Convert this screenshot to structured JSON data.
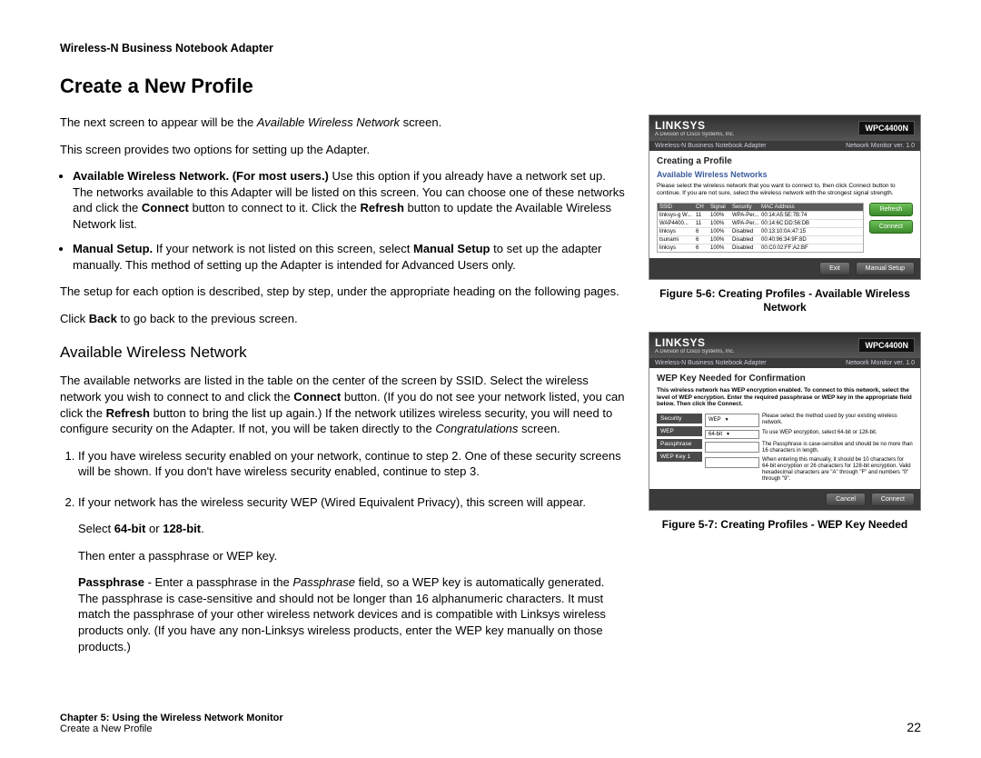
{
  "doc_header": "Wireless-N Business Notebook Adapter",
  "heading": "Create a New Profile",
  "intro_1a": "The next screen to appear will be the ",
  "intro_1b": "Available Wireless Network",
  "intro_1c": " screen.",
  "intro_2": "This screen provides two options for setting up the Adapter.",
  "bullet1_bold": "Available Wireless Network. (For most users.)",
  "bullet1_rest_a": " Use this option if you already have a network set up. The networks available to this Adapter will be listed on this screen. You can choose one of these networks and click the ",
  "bullet1_connect": "Connect",
  "bullet1_rest_b": " button to connect to it. Click the ",
  "bullet1_refresh": "Refresh",
  "bullet1_rest_c": " button to update the Available Wireless Network list.",
  "bullet2_bold": "Manual Setup.",
  "bullet2_rest_a": " If your network is not listed on this screen, select ",
  "bullet2_ms": "Manual Setup",
  "bullet2_rest_b": " to set up the adapter manually. This method of setting up the Adapter is intended for Advanced Users only.",
  "setup_line": "The setup for each option is described, step by step, under the appropriate heading on the following pages.",
  "click_back_a": "Click ",
  "click_back_b": "Back",
  "click_back_c": " to go back to the previous screen.",
  "sub_heading": "Available Wireless Network",
  "awn_p1_a": "The available networks are listed in the table on the center of the screen by SSID. Select the wireless network you wish to connect to and click the ",
  "awn_p1_connect": "Connect",
  "awn_p1_b": " button. (If you do not see your network listed, you can click the ",
  "awn_p1_refresh": "Refresh",
  "awn_p1_c": " button to bring the list up again.) If the network utilizes wireless security, you will need to configure security on the Adapter. If not, you will be taken directly to the ",
  "awn_p1_congrats": "Congratulations",
  "awn_p1_d": " screen.",
  "ol1": "If you have wireless security enabled on your network, continue to step 2. One of these security screens will be shown. If you don't have wireless security enabled, continue to step 3.",
  "ol2_intro": "If your network has the wireless security WEP (Wired Equivalent Privacy), this screen will appear.",
  "ol2_select_a": "Select ",
  "ol2_select_b": "64-bit",
  "ol2_select_c": " or ",
  "ol2_select_d": "128-bit",
  "ol2_select_e": ".",
  "ol2_then": "Then enter a passphrase or WEP key.",
  "ol2_pp_bold": "Passphrase",
  "ol2_pp_a": " - Enter a passphrase in the ",
  "ol2_pp_field": "Passphrase",
  "ol2_pp_b": " field, so a WEP key is automatically generated. The passphrase is case-sensitive and should not be longer than 16 alphanumeric characters. It must match the passphrase of your other wireless network devices and is compatible with Linksys wireless products only. (If you have any non-Linksys wireless products, enter the WEP key manually on those products.)",
  "fig1": {
    "caption": "Figure 5-6: Creating Profiles - Available Wireless Network",
    "brand": "LINKSYS",
    "tagline": "A Division of Cisco Systems, Inc.",
    "badge": "WPC4400N",
    "subtitle_l": "Wireless-N Business Notebook Adapter",
    "subtitle_r": "Network Monitor  ver. 1.0",
    "step_title": "Creating a Profile",
    "section_title": "Available Wireless Networks",
    "instr": "Please select the wireless network that you want to connect to, then click Connect button to continue. If you are not sure, select the wireless network with the strongest signal strength.",
    "th": {
      "ssid": "SSID",
      "ch": "CH",
      "signal": "Signal",
      "sec": "Security",
      "mac": "MAC Address"
    },
    "rows": [
      {
        "ssid": "linksys-g W...",
        "ch": "11",
        "signal": "100%",
        "sec": "WPA-Per...",
        "mac": "00:14:A5:5E:7B:74"
      },
      {
        "ssid": "WAP4400...",
        "ch": "11",
        "signal": "100%",
        "sec": "WPA-Per...",
        "mac": "00:14:6C:DD:56:DB"
      },
      {
        "ssid": "linksys",
        "ch": "6",
        "signal": "100%",
        "sec": "Disabled",
        "mac": "00:13:10:0A:47:15"
      },
      {
        "ssid": "tsunami",
        "ch": "6",
        "signal": "100%",
        "sec": "Disabled",
        "mac": "00:40:96:34:9F:8D"
      },
      {
        "ssid": "linksys",
        "ch": "6",
        "signal": "100%",
        "sec": "Disabled",
        "mac": "00:C0:02:FF:A2:BF"
      }
    ],
    "btn_refresh": "Refresh",
    "btn_connect": "Connect",
    "btn_exit": "Exit",
    "btn_manual": "Manual Setup"
  },
  "fig2": {
    "caption": "Figure 5-7: Creating Profiles - WEP Key Needed",
    "brand": "LINKSYS",
    "tagline": "A Division of Cisco Systems, Inc.",
    "badge": "WPC4400N",
    "subtitle_l": "Wireless-N Business Notebook Adapter",
    "subtitle_r": "Network Monitor  ver. 1.0",
    "title": "WEP Key Needed for Confirmation",
    "instr": "This wireless network has WEP encryption enabled. To connect to this network, select the level of WEP encryption. Enter the required passphrase or WEP key in the appropriate field below. Then click the Connect.",
    "labels": {
      "security": "Security",
      "wep": "WEP",
      "passphrase": "Passphrase",
      "key1": "WEP Key 1"
    },
    "vals": {
      "security": "WEP",
      "wep": "64-bit"
    },
    "right1": "Please select the method used by your existing wireless network.",
    "right2": "To use WEP encryption, select 64-bit or 128-bit.",
    "right3": "The Passphrase is case-sensitive and should be no more than 16 characters in length.",
    "right4": "When entering this manually, it should be 10 characters for 64-bit encryption or 26 characters for 128-bit encryption. Valid hexadecimal characters are \"A\" through \"F\" and numbers \"0\" through \"9\".",
    "btn_cancel": "Cancel",
    "btn_connect": "Connect"
  },
  "footer": {
    "chapter": "Chapter 5: Using the Wireless Network Monitor",
    "sub": "Create a New Profile",
    "page": "22"
  }
}
